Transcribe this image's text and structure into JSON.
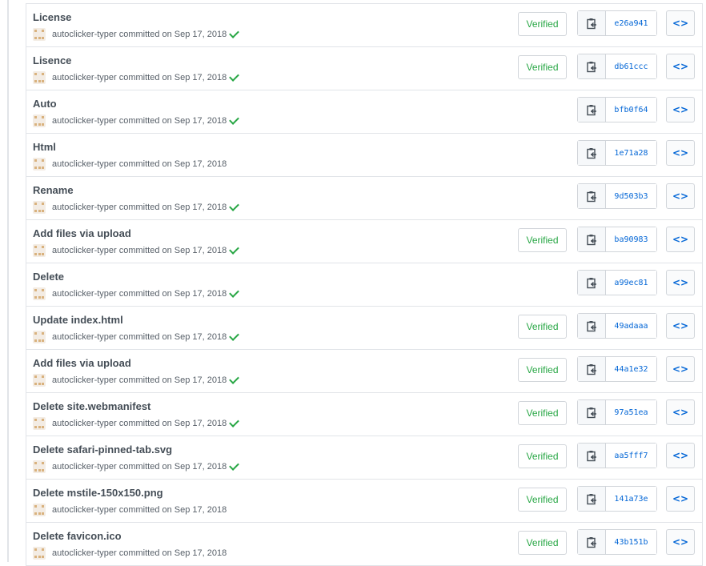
{
  "commits": [
    {
      "title": "License",
      "author": "autoclicker-typer",
      "date_text": "committed on Sep 17, 2018",
      "check": true,
      "verified": true,
      "sha": "e26a941"
    },
    {
      "title": "Lisence",
      "author": "autoclicker-typer",
      "date_text": "committed on Sep 17, 2018",
      "check": true,
      "verified": true,
      "sha": "db61ccc"
    },
    {
      "title": "Auto",
      "author": "autoclicker-typer",
      "date_text": "committed on Sep 17, 2018",
      "check": true,
      "verified": false,
      "sha": "bfb0f64"
    },
    {
      "title": "Html",
      "author": "autoclicker-typer",
      "date_text": "committed on Sep 17, 2018",
      "check": false,
      "verified": false,
      "sha": "1e71a28"
    },
    {
      "title": "Rename",
      "author": "autoclicker-typer",
      "date_text": "committed on Sep 17, 2018",
      "check": true,
      "verified": false,
      "sha": "9d503b3"
    },
    {
      "title": "Add files via upload",
      "author": "autoclicker-typer",
      "date_text": "committed on Sep 17, 2018",
      "check": true,
      "verified": true,
      "sha": "ba90983"
    },
    {
      "title": "Delete",
      "author": "autoclicker-typer",
      "date_text": "committed on Sep 17, 2018",
      "check": true,
      "verified": false,
      "sha": "a99ec81"
    },
    {
      "title": "Update index.html",
      "author": "autoclicker-typer",
      "date_text": "committed on Sep 17, 2018",
      "check": true,
      "verified": true,
      "sha": "49adaaa"
    },
    {
      "title": "Add files via upload",
      "author": "autoclicker-typer",
      "date_text": "committed on Sep 17, 2018",
      "check": true,
      "verified": true,
      "sha": "44a1e32"
    },
    {
      "title": "Delete site.webmanifest",
      "author": "autoclicker-typer",
      "date_text": "committed on Sep 17, 2018",
      "check": true,
      "verified": true,
      "sha": "97a51ea"
    },
    {
      "title": "Delete safari-pinned-tab.svg",
      "author": "autoclicker-typer",
      "date_text": "committed on Sep 17, 2018",
      "check": true,
      "verified": true,
      "sha": "aa5fff7"
    },
    {
      "title": "Delete mstile-150x150.png",
      "author": "autoclicker-typer",
      "date_text": "committed on Sep 17, 2018",
      "check": false,
      "verified": true,
      "sha": "141a73e"
    },
    {
      "title": "Delete favicon.ico",
      "author": "autoclicker-typer",
      "date_text": "committed on Sep 17, 2018",
      "check": false,
      "verified": true,
      "sha": "43b151b"
    }
  ],
  "labels": {
    "verified": "Verified",
    "browse": "<>"
  },
  "icons": {
    "copy": "clipboard-icon",
    "browse": "code-icon",
    "check": "check-icon",
    "avatar": "identicon-avatar"
  },
  "colors": {
    "verified_green": "#28a745",
    "link_blue": "#0366d6",
    "border": "#d1d5da"
  }
}
